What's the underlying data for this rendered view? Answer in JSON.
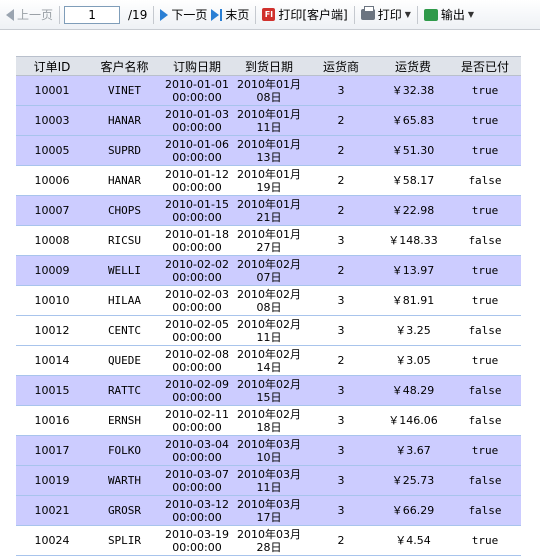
{
  "toolbar": {
    "prev_label": "上一页",
    "page_value": "1",
    "page_total": "/19",
    "next_label": "下一页",
    "last_label": "末页",
    "print_client_label": "打印[客户端]",
    "print_label": "打印",
    "export_label": "输出"
  },
  "table": {
    "headers": [
      "订单ID",
      "客户名称",
      "订购日期",
      "到货日期",
      "运货商",
      "运货费",
      "是否已付"
    ],
    "rows": [
      {
        "id": "10001",
        "customer": "VINET",
        "order_date": "2010-01-01",
        "order_time": "00:00:00",
        "arrival_a": "2010年01月",
        "arrival_b": "08日",
        "shipper": "3",
        "fee": "￥32.38",
        "paid": "true"
      },
      {
        "id": "10003",
        "customer": "HANAR",
        "order_date": "2010-01-03",
        "order_time": "00:00:00",
        "arrival_a": "2010年01月",
        "arrival_b": "11日",
        "shipper": "2",
        "fee": "￥65.83",
        "paid": "true"
      },
      {
        "id": "10005",
        "customer": "SUPRD",
        "order_date": "2010-01-06",
        "order_time": "00:00:00",
        "arrival_a": "2010年01月",
        "arrival_b": "13日",
        "shipper": "2",
        "fee": "￥51.30",
        "paid": "true"
      },
      {
        "id": "10006",
        "customer": "HANAR",
        "order_date": "2010-01-12",
        "order_time": "00:00:00",
        "arrival_a": "2010年01月",
        "arrival_b": "19日",
        "shipper": "2",
        "fee": "￥58.17",
        "paid": "false"
      },
      {
        "id": "10007",
        "customer": "CHOPS",
        "order_date": "2010-01-15",
        "order_time": "00:00:00",
        "arrival_a": "2010年01月",
        "arrival_b": "21日",
        "shipper": "2",
        "fee": "￥22.98",
        "paid": "true"
      },
      {
        "id": "10008",
        "customer": "RICSU",
        "order_date": "2010-01-18",
        "order_time": "00:00:00",
        "arrival_a": "2010年01月",
        "arrival_b": "27日",
        "shipper": "3",
        "fee": "￥148.33",
        "paid": "false"
      },
      {
        "id": "10009",
        "customer": "WELLI",
        "order_date": "2010-02-02",
        "order_time": "00:00:00",
        "arrival_a": "2010年02月",
        "arrival_b": "07日",
        "shipper": "2",
        "fee": "￥13.97",
        "paid": "true"
      },
      {
        "id": "10010",
        "customer": "HILAA",
        "order_date": "2010-02-03",
        "order_time": "00:00:00",
        "arrival_a": "2010年02月",
        "arrival_b": "08日",
        "shipper": "3",
        "fee": "￥81.91",
        "paid": "true"
      },
      {
        "id": "10012",
        "customer": "CENTC",
        "order_date": "2010-02-05",
        "order_time": "00:00:00",
        "arrival_a": "2010年02月",
        "arrival_b": "11日",
        "shipper": "3",
        "fee": "￥3.25",
        "paid": "false"
      },
      {
        "id": "10014",
        "customer": "QUEDE",
        "order_date": "2010-02-08",
        "order_time": "00:00:00",
        "arrival_a": "2010年02月",
        "arrival_b": "14日",
        "shipper": "2",
        "fee": "￥3.05",
        "paid": "true"
      },
      {
        "id": "10015",
        "customer": "RATTC",
        "order_date": "2010-02-09",
        "order_time": "00:00:00",
        "arrival_a": "2010年02月",
        "arrival_b": "15日",
        "shipper": "3",
        "fee": "￥48.29",
        "paid": "false"
      },
      {
        "id": "10016",
        "customer": "ERNSH",
        "order_date": "2010-02-11",
        "order_time": "00:00:00",
        "arrival_a": "2010年02月",
        "arrival_b": "18日",
        "shipper": "3",
        "fee": "￥146.06",
        "paid": "false"
      },
      {
        "id": "10017",
        "customer": "FOLKO",
        "order_date": "2010-03-04",
        "order_time": "00:00:00",
        "arrival_a": "2010年03月",
        "arrival_b": "10日",
        "shipper": "3",
        "fee": "￥3.67",
        "paid": "true"
      },
      {
        "id": "10019",
        "customer": "WARTH",
        "order_date": "2010-03-07",
        "order_time": "00:00:00",
        "arrival_a": "2010年03月",
        "arrival_b": "11日",
        "shipper": "3",
        "fee": "￥25.73",
        "paid": "false"
      },
      {
        "id": "10021",
        "customer": "GROSR",
        "order_date": "2010-03-12",
        "order_time": "00:00:00",
        "arrival_a": "2010年03月",
        "arrival_b": "17日",
        "shipper": "3",
        "fee": "￥66.29",
        "paid": "false"
      },
      {
        "id": "10024",
        "customer": "SPLIR",
        "order_date": "2010-03-19",
        "order_time": "00:00:00",
        "arrival_a": "2010年03月",
        "arrival_b": "28日",
        "shipper": "2",
        "fee": "￥4.54",
        "paid": "true"
      }
    ]
  },
  "colors": {
    "row_highlight": "#ccccff",
    "row_border": "#a8c4ec",
    "accent": "#2a7fd4"
  }
}
